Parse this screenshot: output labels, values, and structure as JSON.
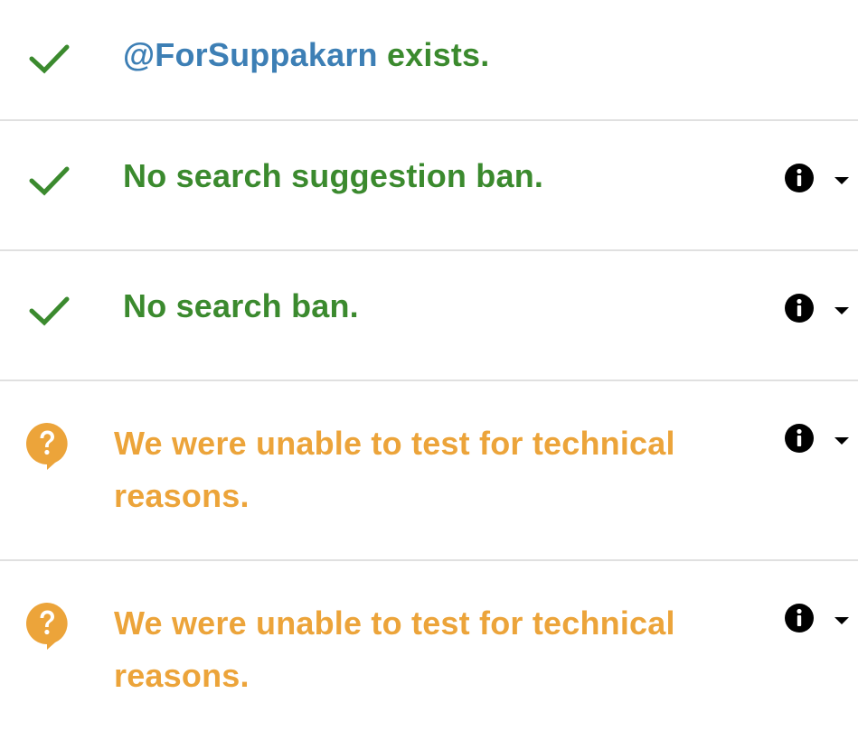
{
  "colors": {
    "success": "#3b8a2e",
    "warning": "#eca43a",
    "handle": "#3d7fb5",
    "divider": "#e0e0e0"
  },
  "results": [
    {
      "status": "success",
      "icon": "check-icon",
      "handle": "@ForSuppakarn",
      "text": " exists."
    },
    {
      "status": "success",
      "icon": "check-icon",
      "text": "No search suggestion ban.",
      "actions": [
        "info-icon",
        "caret-down-icon"
      ]
    },
    {
      "status": "success",
      "icon": "check-icon",
      "text": "No search ban.",
      "actions": [
        "info-icon",
        "caret-down-icon"
      ]
    },
    {
      "status": "warning",
      "icon": "question-bubble-icon",
      "text": "We were unable to test for technical reasons.",
      "actions": [
        "info-icon",
        "caret-down-icon"
      ]
    },
    {
      "status": "warning",
      "icon": "question-bubble-icon",
      "text": "We were unable to test for technical reasons.",
      "actions": [
        "info-icon",
        "caret-down-icon"
      ]
    }
  ]
}
